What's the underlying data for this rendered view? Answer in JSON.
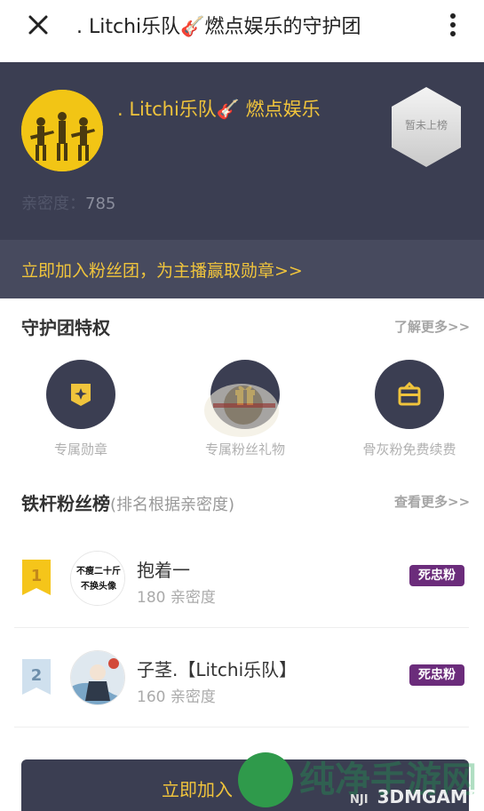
{
  "topbar": {
    "title": ". Litchi乐队🎸燃点娱乐的守护团"
  },
  "hero": {
    "name": ". Litchi乐队🎸 燃点娱乐",
    "intimacy_label": "亲密度：",
    "intimacy_value": "785",
    "rank_text": "暂未上榜"
  },
  "join_banner": "立即加入粉丝团，为主播赢取勋章>>",
  "privileges": {
    "title": "守护团特权",
    "more": "了解更多>>",
    "items": [
      {
        "label": "专属勋章",
        "icon": "badge-icon"
      },
      {
        "label": "专属粉丝礼物",
        "icon": "gift-icon"
      },
      {
        "label": "骨灰粉免费续费",
        "icon": "renew-gift-box-icon"
      }
    ]
  },
  "fans": {
    "title": "铁杆粉丝榜",
    "subtitle": "(排名根据亲密度)",
    "more": "查看更多>>",
    "list": [
      {
        "rank": "1",
        "name": "抱着一",
        "score": "180 亲密度",
        "tag": "死忠粉",
        "avatar_text_1": "不瘦二十斤",
        "avatar_text_2": "不换头像"
      },
      {
        "rank": "2",
        "name": "子茎.【Litchi乐队】",
        "score": "160 亲密度",
        "tag": "死忠粉"
      }
    ]
  },
  "bottom": {
    "label": "立即加入（"
  },
  "watermark": {
    "big": "纯净手游网",
    "small": "3DMGAME",
    "small_left": "NJI"
  },
  "colors": {
    "dark": "#3b3e52",
    "gold": "#f0c43c",
    "tag": "#6b2c7b"
  }
}
